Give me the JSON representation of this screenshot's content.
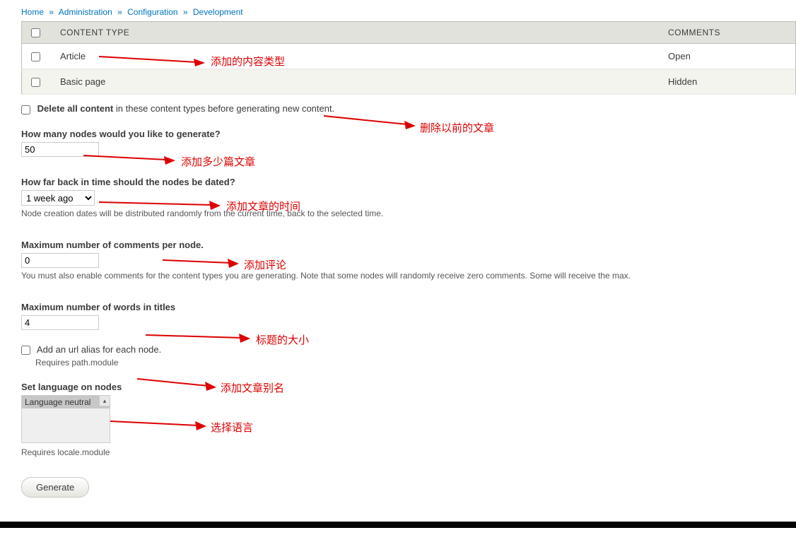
{
  "breadcrumb": {
    "items": [
      "Home",
      "Administration",
      "Configuration",
      "Development"
    ],
    "sep": "»"
  },
  "table": {
    "header_content_type": "CONTENT TYPE",
    "header_comments": "COMMENTS",
    "rows": [
      {
        "name": "Article",
        "comments": "Open"
      },
      {
        "name": "Basic page",
        "comments": "Hidden"
      }
    ]
  },
  "delete_all": {
    "bold": "Delete all content",
    "suffix": " in these content types before generating new content."
  },
  "nodes_count": {
    "label": "How many nodes would you like to generate?",
    "value": "50"
  },
  "date_back": {
    "label": "How far back in time should the nodes be dated?",
    "selected": "1 week ago",
    "description": "Node creation dates will be distributed randomly from the current time, back to the selected time."
  },
  "max_comments": {
    "label": "Maximum number of comments per node.",
    "value": "0",
    "description": "You must also enable comments for the content types you are generating. Note that some nodes will randomly receive zero comments. Some will receive the max."
  },
  "max_words": {
    "label": "Maximum number of words in titles",
    "value": "4"
  },
  "url_alias": {
    "label": "Add an url alias for each node.",
    "requires": "Requires path.module"
  },
  "language": {
    "label": "Set language on nodes",
    "option": "Language neutral",
    "requires": "Requires locale.module"
  },
  "generate_button": "Generate",
  "annotations": {
    "a1": "添加的内容类型",
    "a2": "删除以前的文章",
    "a3": "添加多少篇文章",
    "a4": "添加文章的时间",
    "a5": "添加评论",
    "a6": "标题的大小",
    "a7": "添加文章别名",
    "a8": "选择语言"
  }
}
